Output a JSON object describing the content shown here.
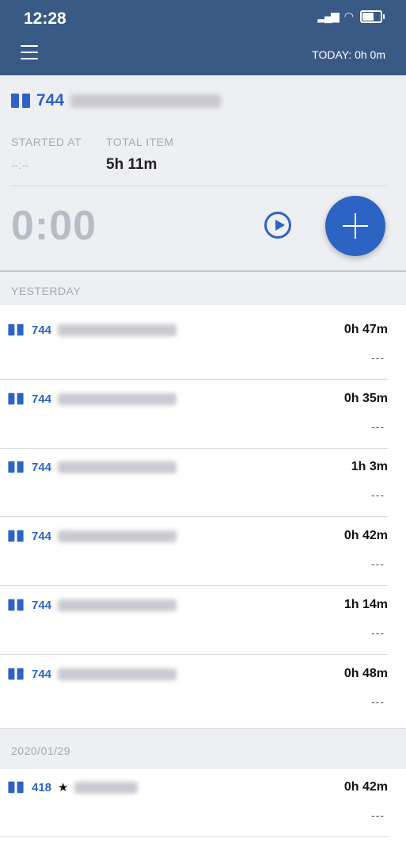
{
  "status_bar": {
    "time": "12:28",
    "location_icon": "location-arrow-icon",
    "signal_icon": "signal-icon",
    "wifi_icon": "wifi-icon",
    "battery_icon": "battery-icon"
  },
  "nav": {
    "menu_icon": "hamburger-icon",
    "today_label": "TODAY: 0h 0m"
  },
  "current_task": {
    "icon": "book-icon",
    "number": "744",
    "started_at_label": "STARTED AT",
    "started_at_value": "--:--",
    "total_item_label": "TOTAL ITEM",
    "total_item_value": "5h 11m",
    "timer": "0:00"
  },
  "sections": [
    {
      "title": "YESTERDAY",
      "entries": [
        {
          "number": "744",
          "duration": "0h 47m",
          "note": "---"
        },
        {
          "number": "744",
          "duration": "0h 35m",
          "note": "---"
        },
        {
          "number": "744",
          "duration": "1h 3m",
          "note": "---"
        },
        {
          "number": "744",
          "duration": "0h 42m",
          "note": "---"
        },
        {
          "number": "744",
          "duration": "1h 14m",
          "note": "---"
        },
        {
          "number": "744",
          "duration": "0h 48m",
          "note": "---"
        }
      ]
    },
    {
      "title": "2020/01/29",
      "entries": [
        {
          "number": "418",
          "starred": "★",
          "duration": "0h 42m",
          "note": "---"
        }
      ]
    }
  ],
  "colors": {
    "nav_bg": "#3a5a86",
    "accent": "#2d63c3",
    "panel_bg": "#eeeff3"
  }
}
